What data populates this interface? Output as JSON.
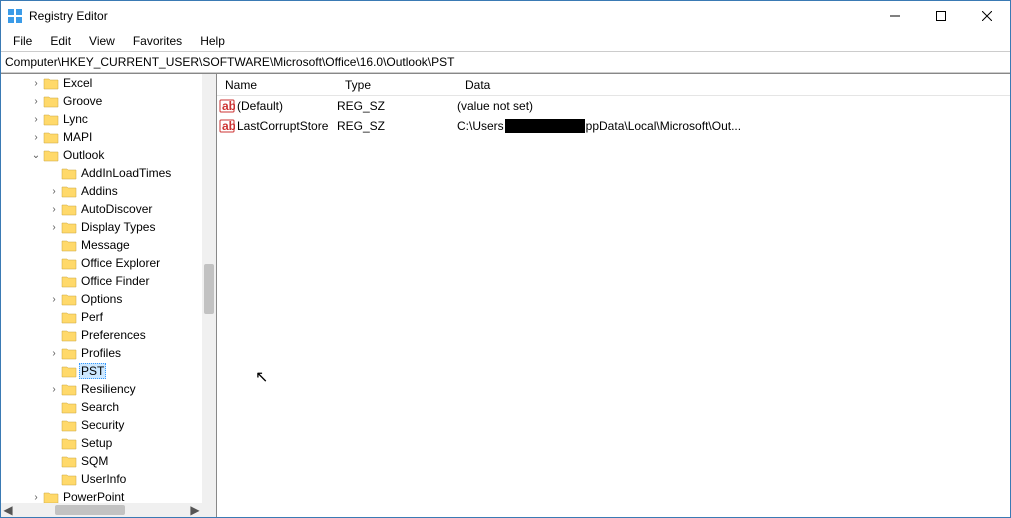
{
  "window": {
    "title": "Registry Editor"
  },
  "menu": {
    "file": "File",
    "edit": "Edit",
    "view": "View",
    "favorites": "Favorites",
    "help": "Help"
  },
  "address": "Computer\\HKEY_CURRENT_USER\\SOFTWARE\\Microsoft\\Office\\16.0\\Outlook\\PST",
  "columns": {
    "name": "Name",
    "type": "Type",
    "data": "Data"
  },
  "values": [
    {
      "name": "(Default)",
      "type": "REG_SZ",
      "data": "(value not set)",
      "redacted": false
    },
    {
      "name": "LastCorruptStore",
      "type": "REG_SZ",
      "data_pre": "C:\\Users",
      "data_post": "ppData\\Local\\Microsoft\\Out...",
      "redacted": true
    }
  ],
  "tree": [
    {
      "lvl": 0,
      "tw": ">",
      "label": "Excel"
    },
    {
      "lvl": 0,
      "tw": ">",
      "label": "Groove"
    },
    {
      "lvl": 0,
      "tw": ">",
      "label": "Lync"
    },
    {
      "lvl": 0,
      "tw": ">",
      "label": "MAPI"
    },
    {
      "lvl": 0,
      "tw": "v",
      "label": "Outlook"
    },
    {
      "lvl": 1,
      "tw": "",
      "label": "AddInLoadTimes"
    },
    {
      "lvl": 1,
      "tw": ">",
      "label": "Addins"
    },
    {
      "lvl": 1,
      "tw": ">",
      "label": "AutoDiscover"
    },
    {
      "lvl": 1,
      "tw": ">",
      "label": "Display Types"
    },
    {
      "lvl": 1,
      "tw": "",
      "label": "Message"
    },
    {
      "lvl": 1,
      "tw": "",
      "label": "Office Explorer"
    },
    {
      "lvl": 1,
      "tw": "",
      "label": "Office Finder"
    },
    {
      "lvl": 1,
      "tw": ">",
      "label": "Options"
    },
    {
      "lvl": 1,
      "tw": "",
      "label": "Perf"
    },
    {
      "lvl": 1,
      "tw": "",
      "label": "Preferences"
    },
    {
      "lvl": 1,
      "tw": ">",
      "label": "Profiles"
    },
    {
      "lvl": 1,
      "tw": "",
      "label": "PST",
      "sel": true
    },
    {
      "lvl": 1,
      "tw": ">",
      "label": "Resiliency"
    },
    {
      "lvl": 1,
      "tw": "",
      "label": "Search"
    },
    {
      "lvl": 1,
      "tw": "",
      "label": "Security"
    },
    {
      "lvl": 1,
      "tw": "",
      "label": "Setup"
    },
    {
      "lvl": 1,
      "tw": "",
      "label": "SQM"
    },
    {
      "lvl": 1,
      "tw": "",
      "label": "UserInfo"
    },
    {
      "lvl": 0,
      "tw": ">",
      "label": "PowerPoint"
    }
  ]
}
